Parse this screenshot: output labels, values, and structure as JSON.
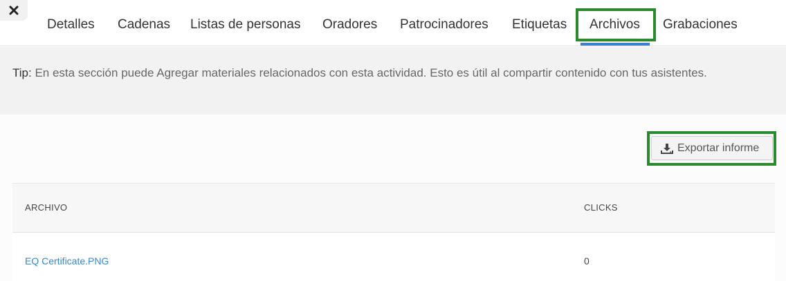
{
  "close": {
    "icon": "close-icon"
  },
  "tabs": [
    {
      "label": "Detalles",
      "active": false
    },
    {
      "label": "Cadenas",
      "active": false
    },
    {
      "label": "Listas de personas",
      "active": false
    },
    {
      "label": "Oradores",
      "active": false
    },
    {
      "label": "Patrocinadores",
      "active": false
    },
    {
      "label": "Etiquetas",
      "active": false
    },
    {
      "label": "Archivos",
      "active": true
    },
    {
      "label": "Grabaciones",
      "active": false
    }
  ],
  "tip": {
    "prefix": "Tip:",
    "text": "En esta sección puede Agregar materiales relacionados con esta actividad. Esto es útil al compartir contenido con tus asistentes."
  },
  "export": {
    "label": "Exportar informe",
    "icon": "download-icon"
  },
  "table": {
    "headers": {
      "file": "ARCHIVO",
      "clicks": "CLICKS"
    },
    "rows": [
      {
        "file": "EQ Certificate.PNG",
        "clicks": "0"
      }
    ]
  },
  "colors": {
    "highlight": "#2b8a2b",
    "active_tab_underline": "#3a7fd0",
    "link": "#3a86cc"
  }
}
